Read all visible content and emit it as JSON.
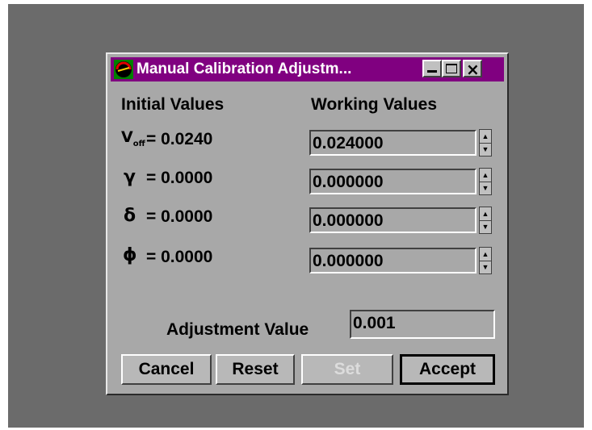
{
  "window": {
    "title": "Manual Calibration Adjustm...",
    "title_bar_color": "#800080",
    "controls": [
      "minimize-icon",
      "maximize-icon",
      "close-icon"
    ],
    "close_glyph": "×"
  },
  "headers": {
    "initial": "Initial Values",
    "working": "Working Values"
  },
  "parameters": [
    {
      "symbol": "V",
      "subscript": "off",
      "initial": "= 0.0240",
      "working": "0.024000"
    },
    {
      "symbol": "γ",
      "initial": "= 0.0000",
      "working": "0.000000"
    },
    {
      "symbol": "δ",
      "initial": "= 0.0000",
      "working": "0.000000"
    },
    {
      "symbol": "ϕ",
      "initial": "= 0.0000",
      "working": "0.000000"
    }
  ],
  "spinner": {
    "up": "▲",
    "down": "▼"
  },
  "adjustment": {
    "label": "Adjustment Value",
    "value": "0.001"
  },
  "buttons": {
    "cancel": "Cancel",
    "reset": "Reset",
    "set": "Set",
    "accept": "Accept"
  }
}
